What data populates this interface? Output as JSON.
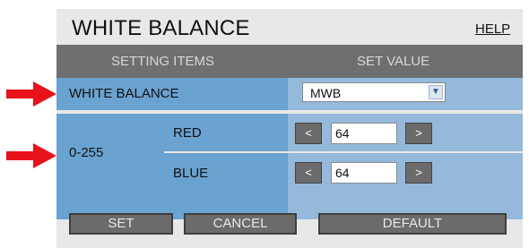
{
  "header": {
    "title": "WHITE BALANCE",
    "help_label": "HELP"
  },
  "table": {
    "col_setting_items": "SETTING ITEMS",
    "col_set_value": "SET VALUE"
  },
  "white_balance": {
    "label": "WHITE BALANCE",
    "selected": "MWB"
  },
  "gain": {
    "range_label": "0-255",
    "red": {
      "label": "RED",
      "value": "64",
      "dec_label": "<",
      "inc_label": ">"
    },
    "blue": {
      "label": "BLUE",
      "value": "64",
      "dec_label": "<",
      "inc_label": ">"
    }
  },
  "buttons": {
    "set": "SET",
    "cancel": "CANCEL",
    "default": "DEFAULT"
  },
  "colors": {
    "arrow": "#e8121a",
    "header_bar": "#6f6f6f",
    "row_light": "#94b9db",
    "row_dark": "#6aa2d0"
  }
}
